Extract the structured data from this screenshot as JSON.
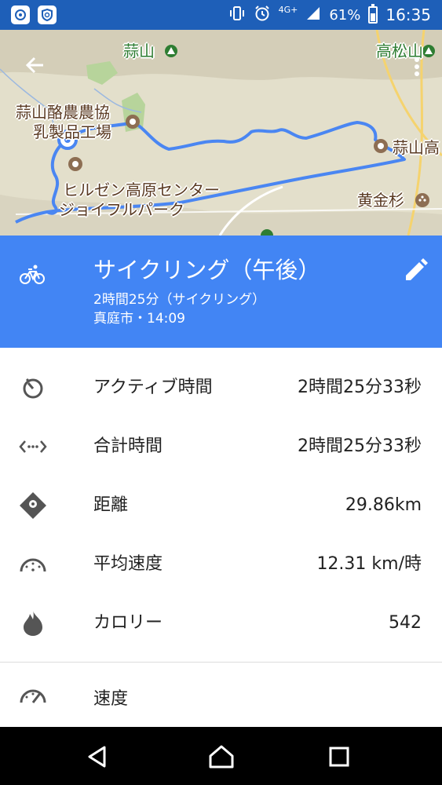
{
  "status_bar": {
    "network": "4G+",
    "battery": "61%",
    "time": "16:35",
    "battery_level": 0.61
  },
  "map": {
    "labels": {
      "mt_hiruzen": "蒜山",
      "mt_takamatsu": "高松山",
      "dairy_line1": "蒜山酪農農協",
      "dairy_line2": "乳製品工場",
      "hiruzen_high": "蒜山高",
      "kogane": "黄金杉",
      "hiruzen_center_line1": "ヒルゼン高原センター",
      "hiruzen_center_line2": "ジョイフルパーク"
    },
    "route_color": "#4a86f2"
  },
  "activity": {
    "icon": "bike-icon",
    "title": "サイクリング（午後）",
    "duration_line": "2時間25分（サイクリング）",
    "location_time": "真庭市・14:09"
  },
  "stats": [
    {
      "icon": "timer-icon",
      "label": "アクティブ時間",
      "value": "2時間25分33秒"
    },
    {
      "icon": "total-time-icon",
      "label": "合計時間",
      "value": "2時間25分33秒"
    },
    {
      "icon": "distance-icon",
      "label": "距離",
      "value": "29.86km"
    },
    {
      "icon": "speedometer-icon",
      "label": "平均速度",
      "value": "12.31 km/時"
    },
    {
      "icon": "flame-icon",
      "label": "カロリー",
      "value": "542"
    }
  ],
  "speed_section": {
    "label": "速度"
  },
  "colors": {
    "status_bar": "#1e5fb8",
    "header": "#4285f4",
    "icon": "#555555"
  }
}
